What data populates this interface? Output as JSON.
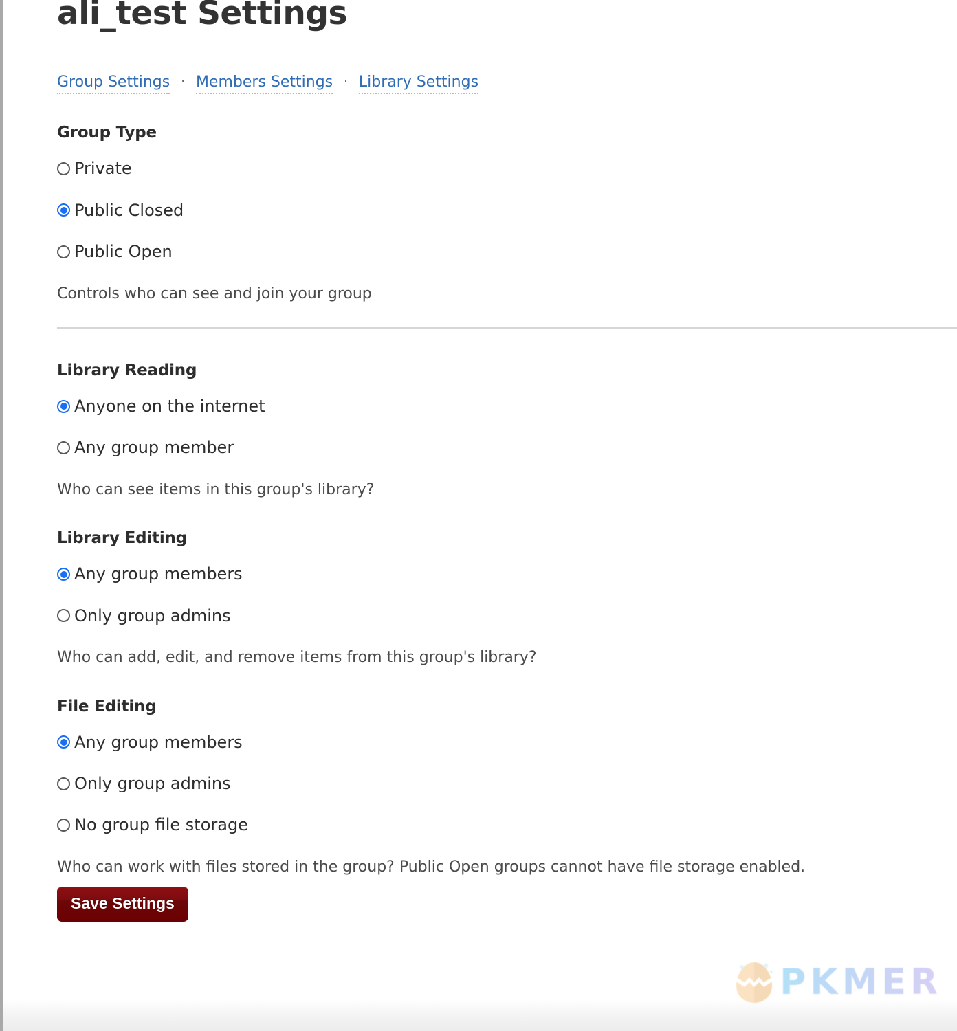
{
  "header": {
    "title": "ali_test Settings",
    "nav": {
      "separator": "·",
      "links": [
        {
          "label": "Group Settings"
        },
        {
          "label": "Members Settings"
        },
        {
          "label": "Library Settings"
        }
      ]
    }
  },
  "sections": {
    "group_type": {
      "title": "Group Type",
      "options": [
        {
          "label": "Private",
          "selected": false
        },
        {
          "label": "Public Closed",
          "selected": true
        },
        {
          "label": "Public Open",
          "selected": false
        }
      ],
      "help": "Controls who can see and join your group"
    },
    "library_reading": {
      "title": "Library Reading",
      "options": [
        {
          "label": "Anyone on the internet",
          "selected": true
        },
        {
          "label": "Any group member",
          "selected": false
        }
      ],
      "help": "Who can see items in this group's library?"
    },
    "library_editing": {
      "title": "Library Editing",
      "options": [
        {
          "label": "Any group members",
          "selected": true
        },
        {
          "label": "Only group admins",
          "selected": false
        }
      ],
      "help": "Who can add, edit, and remove items from this group's library?"
    },
    "file_editing": {
      "title": "File Editing",
      "options": [
        {
          "label": "Any group members",
          "selected": true
        },
        {
          "label": "Only group admins",
          "selected": false
        },
        {
          "label": "No group file storage",
          "selected": false
        }
      ],
      "help": "Who can work with files stored in the group? Public Open groups cannot have file storage enabled."
    }
  },
  "footer": {
    "save_label": "Save Settings"
  },
  "watermark": {
    "text": "PKMER",
    "icon": "egg-shell-icon"
  },
  "colors": {
    "link": "#2f6cb5",
    "radio_selected": "#1a6ef5",
    "save_button": "#7d0c0f",
    "divider": "#d6d6d6",
    "text": "#2d2d2d",
    "help_text": "#4a4a4a"
  }
}
